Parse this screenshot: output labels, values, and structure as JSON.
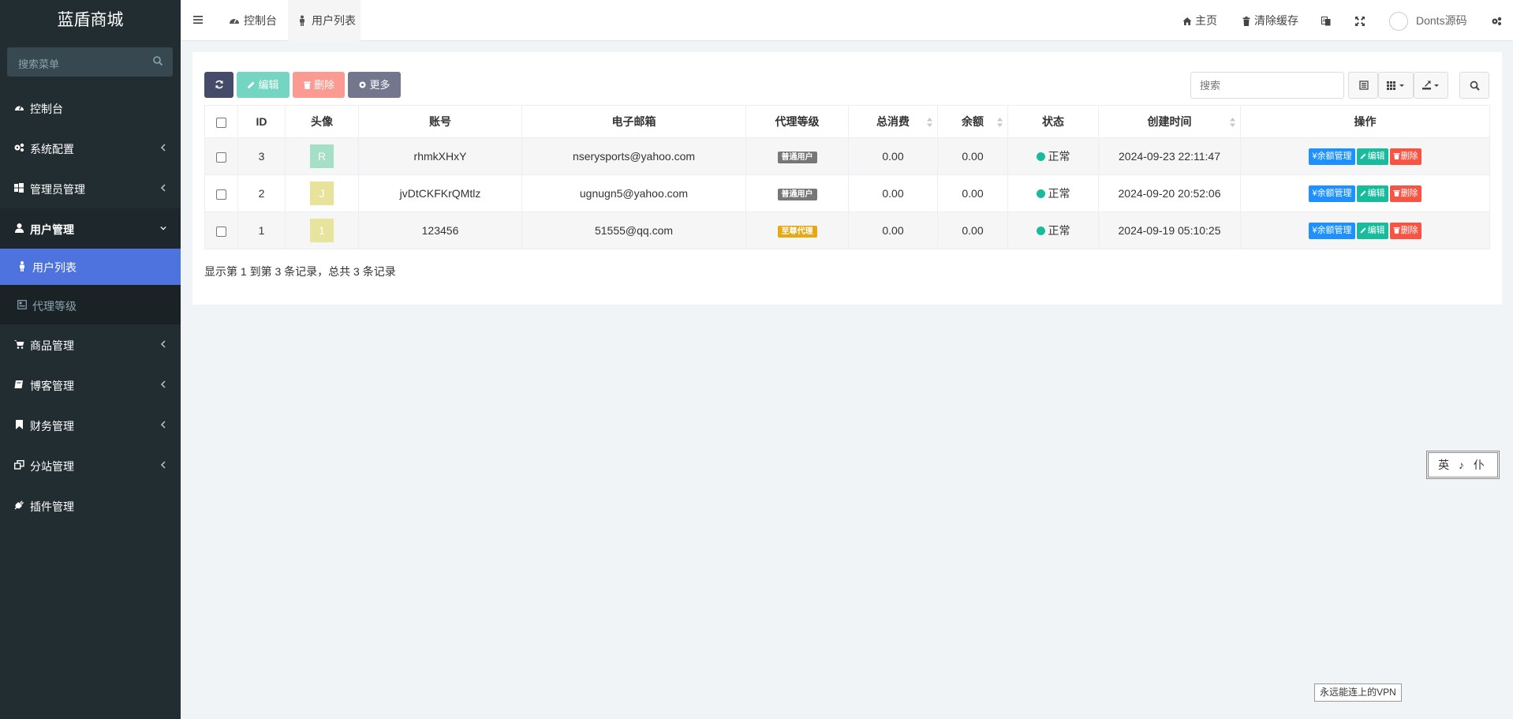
{
  "sidebar": {
    "brand": "蓝盾商城",
    "search_placeholder": "搜索菜单",
    "items": [
      {
        "label": "控制台",
        "icon": "dashboard-icon"
      },
      {
        "label": "系统配置",
        "icon": "cogs-icon"
      },
      {
        "label": "管理员管理",
        "icon": "windows-icon"
      },
      {
        "label": "用户管理",
        "icon": "user-icon"
      },
      {
        "label": "用户列表",
        "icon": "male-icon"
      },
      {
        "label": "代理等级",
        "icon": "list-icon"
      },
      {
        "label": "商品管理",
        "icon": "cart-icon"
      },
      {
        "label": "博客管理",
        "icon": "book-icon"
      },
      {
        "label": "财务管理",
        "icon": "bookmark-icon"
      },
      {
        "label": "分站管理",
        "icon": "clone-icon"
      },
      {
        "label": "插件管理",
        "icon": "plug-icon"
      }
    ]
  },
  "topnav": {
    "tabs": [
      {
        "label": "控制台",
        "icon": "dashboard-icon"
      },
      {
        "label": "用户列表",
        "icon": "male-icon"
      }
    ],
    "home_label": "主页",
    "clear_cache_label": "清除缓存",
    "username": "Donts源码"
  },
  "toolbar": {
    "edit_label": "编辑",
    "delete_label": "删除",
    "more_label": "更多",
    "search_placeholder": "搜索"
  },
  "table": {
    "headers": [
      "ID",
      "头像",
      "账号",
      "电子邮箱",
      "代理等级",
      "总消费",
      "余额",
      "状态",
      "创建时间",
      "操作"
    ],
    "rows": [
      {
        "id": "3",
        "avatar_letter": "R",
        "avatar_color": "#a3e0c7",
        "account": "rhmkXHxY",
        "email": "nserysports@yahoo.com",
        "level": "普通用户",
        "level_color": "#777777",
        "total": "0.00",
        "balance": "0.00",
        "status": "正常",
        "created": "2024-09-23 22:11:47"
      },
      {
        "id": "2",
        "avatar_letter": "J",
        "avatar_color": "#e8e29a",
        "account": "jvDtCKFKrQMtlz",
        "email": "ugnugn5@yahoo.com",
        "level": "普通用户",
        "level_color": "#777777",
        "total": "0.00",
        "balance": "0.00",
        "status": "正常",
        "created": "2024-09-20 20:52:06"
      },
      {
        "id": "1",
        "avatar_letter": "1",
        "avatar_color": "#e6e49d",
        "account": "123456",
        "email": "51555@qq.com",
        "level": "至尊代理",
        "level_color": "#e5a914",
        "total": "0.00",
        "balance": "0.00",
        "status": "正常",
        "created": "2024-09-19 05:10:25"
      }
    ],
    "ops": {
      "balance_label": "余额管理",
      "edit_label": "编辑",
      "delete_label": "删除"
    }
  },
  "pagination_info": "显示第 1 到第 3 条记录，总共 3 条记录",
  "float_lang": "英 ♪ 仆",
  "vpn_tag": "永远能连上的VPN",
  "colors": {
    "sidebar_bg": "#222d32",
    "active_menu": "#4e73df",
    "primary": "#1e90ff",
    "success": "#18bc9c",
    "danger": "#f75444",
    "dark_btn": "#444c69"
  }
}
